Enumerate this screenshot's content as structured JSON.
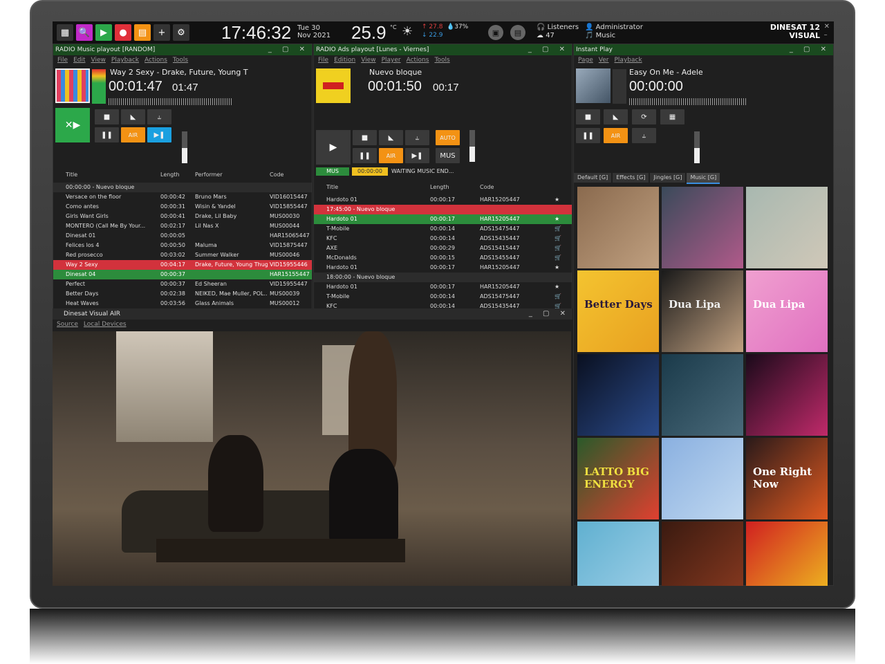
{
  "topbar": {
    "clock": "17:46:32",
    "date_line1": "Tue 30",
    "date_line2": "Nov 2021",
    "temperature": "25.9",
    "temp_unit": "°C",
    "temp_max": "↑ 27.8",
    "temp_min": "↓ 22.9",
    "humidity": "37%",
    "listeners_label": "Listeners",
    "listeners_count": "47",
    "user_label": "Administrator",
    "user_sub": "Music",
    "brand_line1": "DINESAT 12",
    "brand_line2": "VISUAL",
    "buttons": [
      "grid-icon",
      "search-icon",
      "play-icon",
      "record-icon",
      "calendar-icon",
      "plus-icon",
      "gear-icon"
    ],
    "button_colors": [
      "#333333",
      "#c02ac8",
      "#2ca84a",
      "#e0303a",
      "#f39214",
      "#333333",
      "#333333"
    ]
  },
  "music_panel": {
    "title": "RADIO Music playout [RANDOM]",
    "menu": [
      "File",
      "Edit",
      "View",
      "Playback",
      "Actions",
      "Tools"
    ],
    "song": "Way 2 Sexy - Drake, Future, Young T",
    "time": "00:01:47",
    "remaining": "01:47",
    "btn_air": "AIR",
    "headers": [
      "Title",
      "Length",
      "Performer",
      "Code"
    ],
    "rows": [
      {
        "type": "grp",
        "title": "00:00:00 - Nuevo bloque",
        "len": "",
        "perf": "",
        "code": ""
      },
      {
        "type": "n",
        "title": "Versace on the floor",
        "len": "00:00:42",
        "perf": "Bruno Mars",
        "code": "VID16015447"
      },
      {
        "type": "n",
        "title": "Como antes",
        "len": "00:00:31",
        "perf": "Wisin & Yandel",
        "code": "VID15855447"
      },
      {
        "type": "n",
        "title": "Girls Want Girls",
        "len": "00:00:41",
        "perf": "Drake, Lil Baby",
        "code": "MUS00030"
      },
      {
        "type": "n",
        "title": "MONTERO (Call Me By Your...",
        "len": "00:02:17",
        "perf": "Lil Nas X",
        "code": "MUS00044"
      },
      {
        "type": "n",
        "title": "Dinesat 01",
        "len": "00:00:05",
        "perf": "",
        "code": "HAR15065447"
      },
      {
        "type": "n",
        "title": "Felices los 4",
        "len": "00:00:50",
        "perf": "Maluma",
        "code": "VID15875447"
      },
      {
        "type": "n",
        "title": "Red prosecco",
        "len": "00:03:02",
        "perf": "Summer Walker",
        "code": "MUS00046"
      },
      {
        "type": "red",
        "title": "Way 2 Sexy",
        "len": "00:04:17",
        "perf": "Drake, Future, Young Thug",
        "code": "VID15955446"
      },
      {
        "type": "grn",
        "title": "Dinesat 04",
        "len": "00:00:37",
        "perf": "",
        "code": "HAR15155447"
      },
      {
        "type": "n",
        "title": "Perfect",
        "len": "00:00:37",
        "perf": "Ed Sheeran",
        "code": "VID15955447"
      },
      {
        "type": "n",
        "title": "Better Days",
        "len": "00:02:38",
        "perf": "NEIKED, Mae Muller, POL...",
        "code": "MUS00039"
      },
      {
        "type": "n",
        "title": "Heat Waves",
        "len": "00:03:56",
        "perf": "Glass Animals",
        "code": "MUS00012"
      }
    ]
  },
  "ads_panel": {
    "title": "RADIO Ads playout [Lunes - Viernes]",
    "menu": [
      "File",
      "Edition",
      "View",
      "Player",
      "Actions",
      "Tools"
    ],
    "song": "Nuevo bloque",
    "time": "00:01:50",
    "remaining": "00:17",
    "btn_auto": "AUTO",
    "btn_air": "AIR",
    "btn_mus": "MUS",
    "status_mus": "MUS",
    "status_time": "00:00:00",
    "status_text": "WAITING MUSIC END...",
    "headers": [
      "Title",
      "Length",
      "Code"
    ],
    "rows": [
      {
        "type": "n",
        "title": "Hardoto 01",
        "len": "00:00:17",
        "code": "HAR15205447"
      },
      {
        "type": "red",
        "title": "17:45:00 - Nuevo bloque",
        "len": "",
        "code": ""
      },
      {
        "type": "grn",
        "title": "Hardoto 01",
        "len": "00:00:17",
        "code": "HAR15205447"
      },
      {
        "type": "n",
        "title": "T-Mobile",
        "len": "00:00:14",
        "code": "ADS15475447"
      },
      {
        "type": "n",
        "title": "KFC",
        "len": "00:00:14",
        "code": "ADS15435447"
      },
      {
        "type": "n",
        "title": "AXE",
        "len": "00:00:29",
        "code": "ADS15415447"
      },
      {
        "type": "n",
        "title": "McDonalds",
        "len": "00:00:15",
        "code": "ADS15455447"
      },
      {
        "type": "n",
        "title": "Hardoto 01",
        "len": "00:00:17",
        "code": "HAR15205447"
      },
      {
        "type": "grp",
        "title": "18:00:00 - Nuevo bloque",
        "len": "",
        "code": ""
      },
      {
        "type": "n",
        "title": "Hardoto 01",
        "len": "00:00:17",
        "code": "HAR15205447"
      },
      {
        "type": "n",
        "title": "T-Mobile",
        "len": "00:00:14",
        "code": "ADS15475447"
      },
      {
        "type": "n",
        "title": "KFC",
        "len": "00:00:14",
        "code": "ADS15435447"
      }
    ]
  },
  "instant_panel": {
    "title": "Instant Play",
    "menu": [
      "Page",
      "Ver",
      "Playback"
    ],
    "song": "Easy On Me - Adele",
    "time": "00:00:00",
    "btn_air": "AIR",
    "tabs": [
      "Default [G]",
      "Effects [G]",
      "Jingles [G]",
      "Music [G]"
    ],
    "active_tab": "Music [G]",
    "covers": [
      {
        "c1": "#8a6a4e",
        "c2": "#c0a080"
      },
      {
        "c1": "#3a4a5a",
        "c2": "#b05a8a"
      },
      {
        "c1": "#a8b8b0",
        "c2": "#d0c8b8"
      },
      {
        "c1": "#f4c430",
        "c2": "#e8a020",
        "text": "Better Days",
        "tc": "#2a1a3a"
      },
      {
        "c1": "#1a1a1a",
        "c2": "#c0a080",
        "text": "Dua Lipa",
        "tc": "#eee"
      },
      {
        "c1": "#f0a0d0",
        "c2": "#e070c0",
        "text": "Dua Lipa",
        "tc": "#fff"
      },
      {
        "c1": "#0a1020",
        "c2": "#2a4a8a"
      },
      {
        "c1": "#1a3a4a",
        "c2": "#4a6a7a"
      },
      {
        "c1": "#1a0a1a",
        "c2": "#c02a6a"
      },
      {
        "c1": "#2a5a2a",
        "c2": "#e04030",
        "text": "LATTO BIG ENERGY",
        "tc": "#f0e040"
      },
      {
        "c1": "#8ab0e0",
        "c2": "#c0d8f0"
      },
      {
        "c1": "#2a1a1a",
        "c2": "#e05a20",
        "text": "One Right Now",
        "tc": "#fff"
      },
      {
        "c1": "#60b0d0",
        "c2": "#a0d0e8"
      },
      {
        "c1": "#3a1a10",
        "c2": "#8a3a20"
      },
      {
        "c1": "#d02020",
        "c2": "#f0c020"
      }
    ]
  },
  "air_panel": {
    "title": "Dinesat Visual AIR",
    "menu": [
      "Source",
      "Local Devices"
    ]
  }
}
